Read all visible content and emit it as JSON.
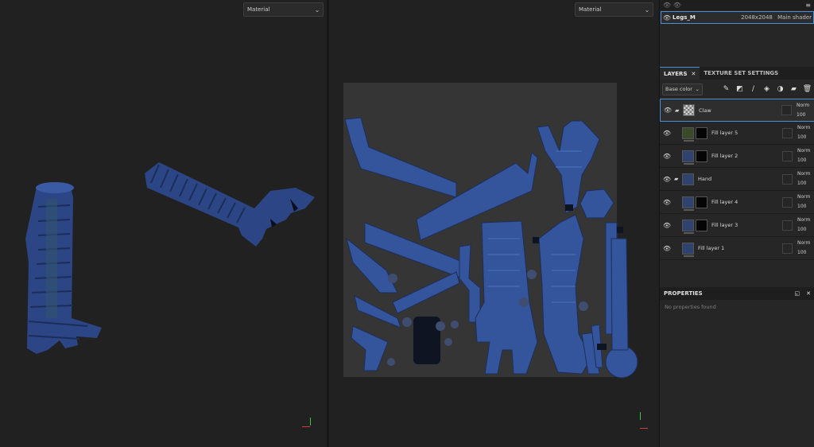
{
  "viewport3d": {
    "shading_select": "Material"
  },
  "viewport2d": {
    "shading_select": "Material"
  },
  "texture_set_list": {
    "row": {
      "name": "Legs_M",
      "resolution": "2048x2048",
      "shader": "Main shader"
    }
  },
  "layers_panel": {
    "tabs": [
      {
        "label": "LAYERS",
        "close": "✕"
      },
      {
        "label": "TEXTURE SET SETTINGS"
      }
    ],
    "channel_select": "Base color",
    "tool_icons": [
      "paint-brush-icon",
      "smart-material-icon",
      "brush-icon",
      "fill-icon",
      "effects-icon",
      "folder-icon",
      "trash-icon"
    ],
    "layers": [
      {
        "name": "Claw",
        "type": "folder",
        "blend": "Norm",
        "opacity": "100",
        "thumb": "checker",
        "mask": false
      },
      {
        "name": "Fill layer 5",
        "type": "fill",
        "blend": "Norm",
        "opacity": "100",
        "thumb": "green",
        "mask": true
      },
      {
        "name": "Fill layer 2",
        "type": "fill",
        "blend": "Norm",
        "opacity": "100",
        "thumb": "blue",
        "mask": true
      },
      {
        "name": "Hand",
        "type": "folder",
        "blend": "Norm",
        "opacity": "100",
        "thumb": "blue",
        "mask": false
      },
      {
        "name": "Fill layer 4",
        "type": "fill",
        "blend": "Norm",
        "opacity": "100",
        "thumb": "blue",
        "mask": true
      },
      {
        "name": "Fill layer 3",
        "type": "fill",
        "blend": "Norm",
        "opacity": "100",
        "thumb": "blue",
        "mask": true
      },
      {
        "name": "Fill layer 1",
        "type": "fill",
        "blend": "Norm",
        "opacity": "100",
        "thumb": "blue",
        "mask": false
      }
    ]
  },
  "properties": {
    "title": "PROPERTIES",
    "empty_text": "No properties found"
  },
  "colors": {
    "accent": "#4a90d9",
    "mesh_blue": "#2f4a8a",
    "uv_bg": "#353535"
  }
}
